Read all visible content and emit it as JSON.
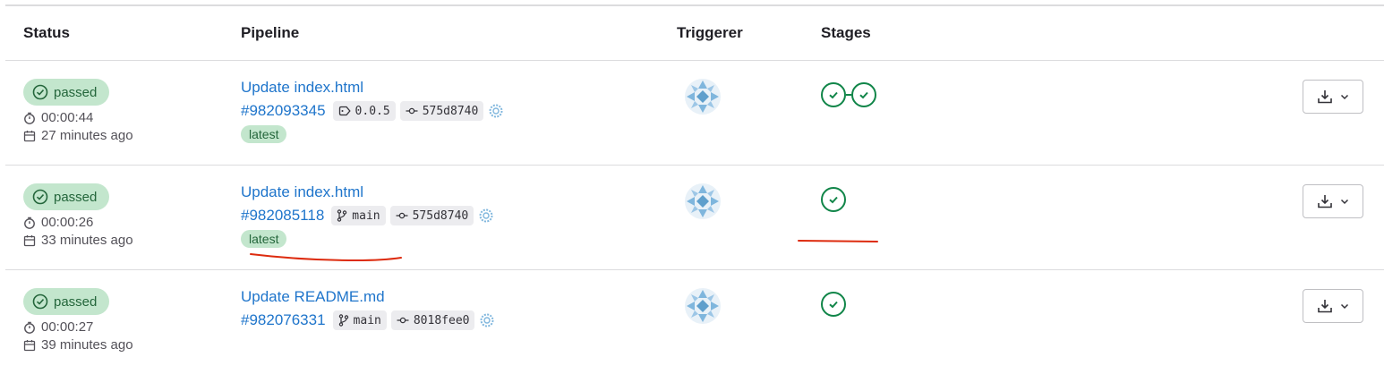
{
  "table": {
    "headers": {
      "status": "Status",
      "pipeline": "Pipeline",
      "triggerer": "Triggerer",
      "stages": "Stages"
    },
    "rows": [
      {
        "status": "passed",
        "duration": "00:00:44",
        "finished": "27 minutes ago",
        "title": "Update index.html",
        "pipeline_id": "#982093345",
        "ref_type": "tag",
        "ref": "0.0.5",
        "commit": "575d8740",
        "badge": "latest",
        "stages": [
          "passed",
          "passed"
        ]
      },
      {
        "status": "passed",
        "duration": "00:00:26",
        "finished": "33 minutes ago",
        "title": "Update index.html",
        "pipeline_id": "#982085118",
        "ref_type": "branch",
        "ref": "main",
        "commit": "575d8740",
        "badge": "latest",
        "stages": [
          "passed"
        ]
      },
      {
        "status": "passed",
        "duration": "00:00:27",
        "finished": "39 minutes ago",
        "title": "Update README.md",
        "pipeline_id": "#982076331",
        "ref_type": "branch",
        "ref": "main",
        "commit": "8018fee0",
        "badge": "",
        "stages": [
          "passed"
        ]
      }
    ]
  },
  "colors": {
    "success_bg": "#c3e6cd",
    "success_text": "#24663b",
    "success_icon": "#108548",
    "link": "#1f75cb",
    "annotation": "#dd2b0e"
  },
  "icons": {
    "status": "status-success-icon",
    "duration": "timer-icon",
    "date": "calendar-icon",
    "tag": "label-icon",
    "branch": "branch-icon",
    "commit": "commit-icon",
    "trigger": "gear-icon",
    "download": "download-icon",
    "dropdown": "chevron-down-icon"
  }
}
